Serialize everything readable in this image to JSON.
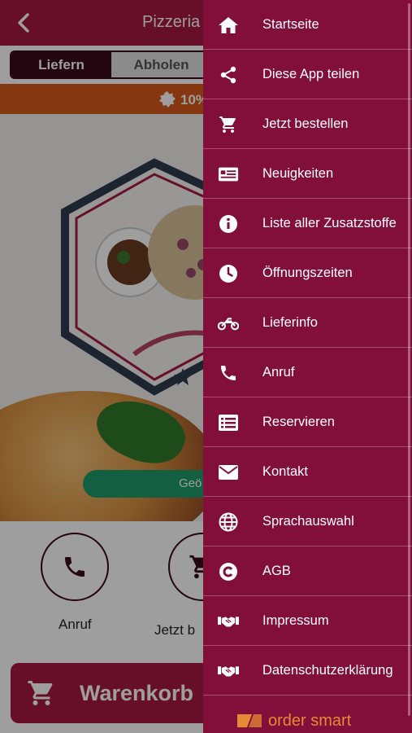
{
  "header": {
    "title": "Pizzeria d"
  },
  "tabs": [
    {
      "label": "Liefern",
      "active": true
    },
    {
      "label": "Abholen",
      "active": false
    }
  ],
  "promo": {
    "text": "10%"
  },
  "hero": {
    "button_label": "Geö"
  },
  "actions": [
    {
      "label": "Anruf",
      "icon": "phone-icon"
    },
    {
      "label": "Jetzt b",
      "icon": "cart-icon"
    }
  ],
  "cart": {
    "label": "Warenkorb"
  },
  "drawer": {
    "items": [
      {
        "label": "Startseite",
        "icon": "home-icon"
      },
      {
        "label": "Diese App teilen",
        "icon": "share-icon"
      },
      {
        "label": "Jetzt bestellen",
        "icon": "cart-icon"
      },
      {
        "label": "Neuigkeiten",
        "icon": "news-icon"
      },
      {
        "label": "Liste aller Zusatzstoffe",
        "icon": "info-icon"
      },
      {
        "label": "Öffnungszeiten",
        "icon": "clock-icon"
      },
      {
        "label": "Lieferinfo",
        "icon": "motorcycle-icon"
      },
      {
        "label": "Anruf",
        "icon": "phone-icon"
      },
      {
        "label": "Reservieren",
        "icon": "list-icon"
      },
      {
        "label": "Kontakt",
        "icon": "envelope-icon"
      },
      {
        "label": "Sprachauswahl",
        "icon": "globe-icon"
      },
      {
        "label": "AGB",
        "icon": "copyright-icon"
      },
      {
        "label": "Impressum",
        "icon": "handshake-icon"
      },
      {
        "label": "Datenschutzerklärung",
        "icon": "handshake-icon"
      }
    ],
    "brand": "order smart"
  },
  "colors": {
    "header": "#a61745",
    "drawer": "#810f3a",
    "promo": "#d65a1c",
    "accent_dark": "#3b0a1a",
    "button_green": "#1f9a6a",
    "brand_orange": "#e58a35"
  }
}
